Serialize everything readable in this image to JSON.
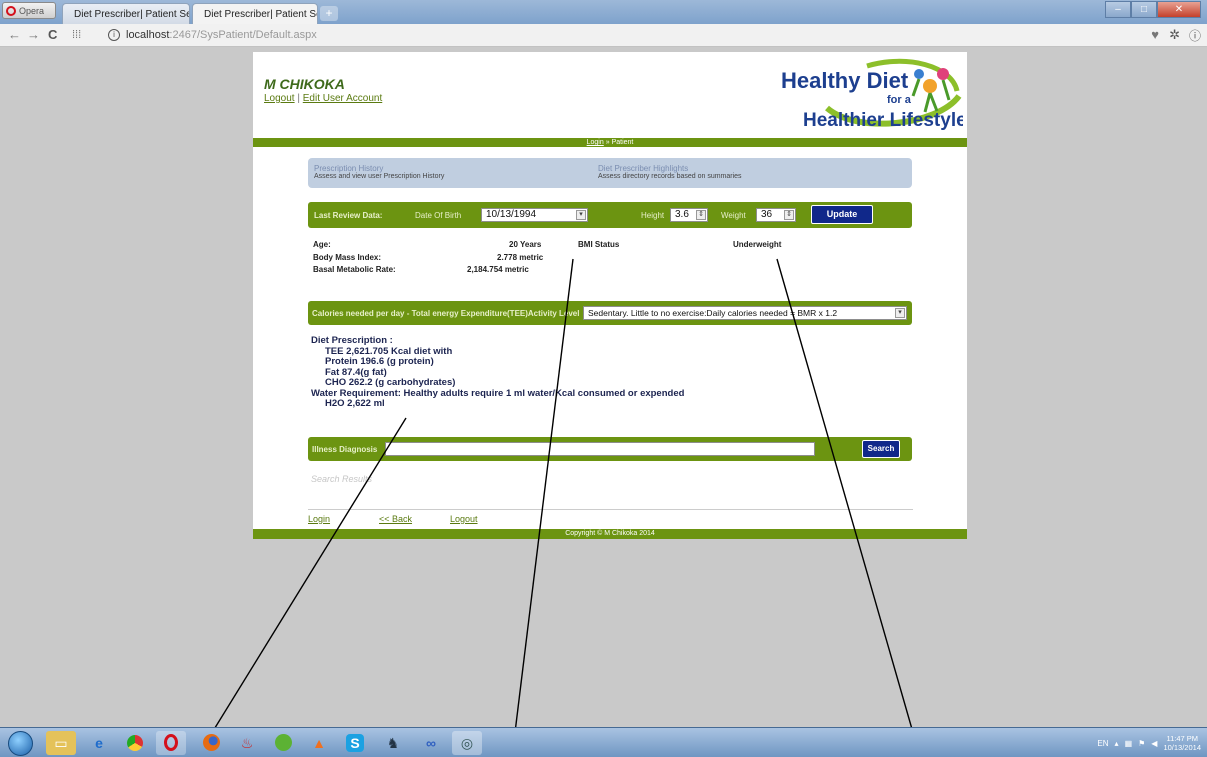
{
  "browser": {
    "opera_label": "Opera",
    "tabs": [
      {
        "title": "Diet Prescriber| Patient Se"
      },
      {
        "title": "Diet Prescriber| Patient Se"
      }
    ],
    "address": {
      "host": "localhost",
      "rest": ":2467/SysPatient/Default.aspx"
    }
  },
  "header": {
    "user_name": "M CHIKOKA",
    "logout": "Logout",
    "separator": "|",
    "edit_account": "Edit User Account",
    "logo": {
      "line1": "Healthy Diet",
      "line2": "for a",
      "line3": "Healthier Lifestyle"
    }
  },
  "breadcrumb": {
    "login": "Login",
    "separator": "»",
    "current": "Patient"
  },
  "info_panel": {
    "history_title": "Prescription History",
    "history_sub": "Assess and view user Prescription History",
    "highlights_title": "Diet Prescriber Highlights",
    "highlights_sub": "Assess directory records based on summaries"
  },
  "review": {
    "last_review": "Last Review Data:",
    "dob_label": "Date Of Birth",
    "dob_value": "10/13/1994",
    "height_label": "Height",
    "height_value": "3.6",
    "weight_label": "Weight",
    "weight_value": "36",
    "update": "Update"
  },
  "stats": {
    "age_label": "Age:",
    "age_value": "20 Years",
    "bmi_status_label": "BMI Status",
    "bmi_status_value": "Underweight",
    "bmi_label": "Body Mass Index:",
    "bmi_value": "2.778 metric",
    "bmr_label": "Basal Metabolic Rate:",
    "bmr_value": "2,184.754 metric"
  },
  "activity": {
    "label": "Calories needed per day - Total energy Expenditure(TEE)Activity Level",
    "selected": "Sedentary.  Little to no exercise:Daily calories needed = BMR x 1.2"
  },
  "prescription": {
    "title": "Diet Prescription :",
    "tee": "TEE 2,621.705 Kcal diet with",
    "protein": "Protein 196.6 (g protein)",
    "fat": "Fat 87.4(g fat)",
    "cho": "CHO 262.2 (g carbohydrates)",
    "water": "Water Requirement: Healthy adults require 1 ml water/Kcal consumed or expended",
    "h2o": "H2O 2,622 ml"
  },
  "diagnosis": {
    "label": "Illness Diagnosis",
    "search": "Search",
    "results": "Search Results"
  },
  "footer": {
    "login": "Login",
    "back": "<< Back",
    "logout": "Logout",
    "copyright": "Copyright © M Chikoka 2014"
  },
  "taskbar": {
    "lang": "EN",
    "time": "11:47 PM",
    "date": "10/13/2014"
  },
  "colors": {
    "accent_green": "#6c9411",
    "dark_blue_button": "#10288a",
    "panel_blue": "#c0cee0"
  }
}
